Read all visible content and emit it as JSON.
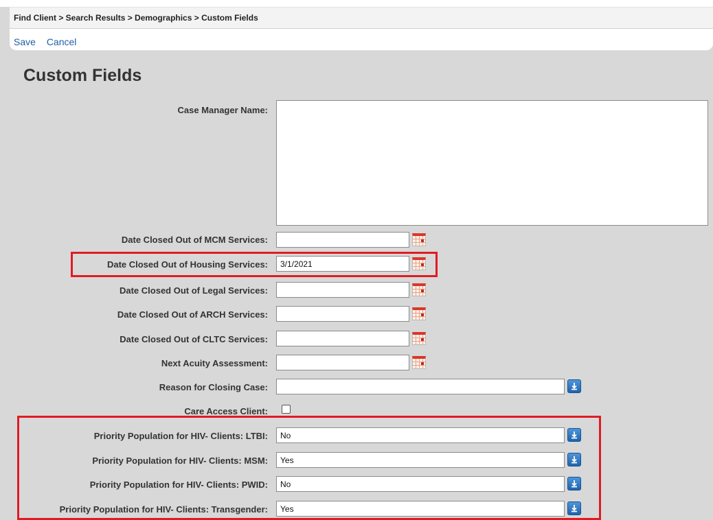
{
  "breadcrumb": "Find Client > Search Results > Demographics > Custom Fields",
  "actions": {
    "save": "Save",
    "cancel": "Cancel"
  },
  "page_title": "Custom Fields",
  "fields": {
    "case_manager_name": {
      "label": "Case Manager Name:",
      "value": ""
    },
    "date_closed_mcm": {
      "label": "Date Closed Out of MCM Services:",
      "value": ""
    },
    "date_closed_housing": {
      "label": "Date Closed Out of Housing Services:",
      "value": "3/1/2021"
    },
    "date_closed_legal": {
      "label": "Date Closed Out of Legal Services:",
      "value": ""
    },
    "date_closed_arch": {
      "label": "Date Closed Out of ARCH Services:",
      "value": ""
    },
    "date_closed_cltc": {
      "label": "Date Closed Out of CLTC Services:",
      "value": ""
    },
    "next_acuity_assessment": {
      "label": "Next Acuity Assessment:",
      "value": ""
    },
    "reason_for_closing": {
      "label": "Reason for Closing Case:",
      "value": ""
    },
    "care_access_client": {
      "label": "Care Access Client:",
      "checked": false
    },
    "priority_ltbi": {
      "label": "Priority Population for HIV- Clients: LTBI:",
      "value": "No"
    },
    "priority_msm": {
      "label": "Priority Population for HIV- Clients: MSM:",
      "value": "Yes"
    },
    "priority_pwid": {
      "label": "Priority Population for HIV- Clients: PWID:",
      "value": "No"
    },
    "priority_transgender": {
      "label": "Priority Population for HIV- Clients: Transgender:",
      "value": "Yes"
    }
  },
  "icons": {
    "calendar": "calendar-icon",
    "dropdown": "dropdown-arrow-icon"
  },
  "colors": {
    "highlight": "#e01b24",
    "link": "#1f5fa8",
    "dropdown_button": "#2a74bf"
  }
}
